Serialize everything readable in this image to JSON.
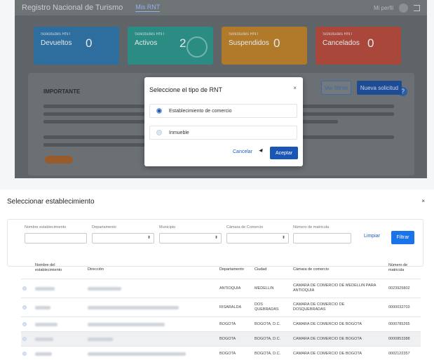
{
  "top_panel": {
    "header": {
      "title": "Registro Nacional de Turismo",
      "tab": "Mis RNT",
      "user": "Mi perfil"
    },
    "cards": [
      {
        "small": "Solicitudes RNT",
        "label": "Devueltos",
        "count": "0",
        "color": "#2d6e9f"
      },
      {
        "small": "Solicitudes RNT",
        "label": "Activos",
        "count": "2",
        "color": "#2a8c83"
      },
      {
        "small": "Solicitudes RNT",
        "label": "Suspendidos",
        "count": "0",
        "color": "#b07a2a"
      },
      {
        "small": "Solicitudes RNT",
        "label": "Cancelados",
        "count": "0",
        "color": "#a9473a"
      }
    ],
    "important": {
      "title": "IMPORTANTE",
      "help_icon": "?"
    },
    "buttons": {
      "filtros": "Ver filtros",
      "nueva": "Nueva solicitud"
    },
    "modal": {
      "title": "Seleccione el tipo de RNT",
      "close": "×",
      "options": [
        {
          "label": "Establecimiento de comercio",
          "selected": true
        },
        {
          "label": "Inmueble",
          "selected": false
        }
      ],
      "cancel": "Cancelar",
      "accept": "Aceptar"
    }
  },
  "bottom_panel": {
    "title": "Seleccionar establecimiento",
    "close": "×",
    "filters": {
      "nombre": "Nombre establecimiento",
      "departamento": "Departamento",
      "municipio": "Municipio",
      "camara": "Cámara de Comercio",
      "matricula": "Número de matricula",
      "limpiar": "Limpiar",
      "filtrar": "Filtrar"
    },
    "table": {
      "headers": [
        "Nombre del establecimiento",
        "Dirección",
        "Departamento",
        "Ciudad",
        "Cámara de comercio",
        "Número de matricula"
      ],
      "rows": [
        {
          "departamento": "ANTIOQUIA",
          "ciudad": "MEDELLIN",
          "camara": "CAMARA DE COMERCIO DE MEDELLIN PARA ANTIOQUIA",
          "matricula": "0023925802"
        },
        {
          "departamento": "RISARALDA",
          "ciudad": "DOS QUEBRADAS",
          "camara": "CAMARA DE COMERCIO DE DOSQUEBRADAS",
          "matricula": "0000032703"
        },
        {
          "departamento": "BOGOTA",
          "ciudad": "BOGOTA, D.C.",
          "camara": "CAMARA DE COMERCIO DE BOGOTA",
          "matricula": "0000785265"
        },
        {
          "departamento": "BOGOTA",
          "ciudad": "BOGOTA, D.C.",
          "camara": "CAMARA DE COMERCIO DE BOGOTA",
          "matricula": "0000853388"
        },
        {
          "departamento": "BOGOTA",
          "ciudad": "BOGOTA, D.C.",
          "camara": "CAMARA DE COMERCIO DE BOGOTA",
          "matricula": "0002122357"
        }
      ]
    }
  }
}
